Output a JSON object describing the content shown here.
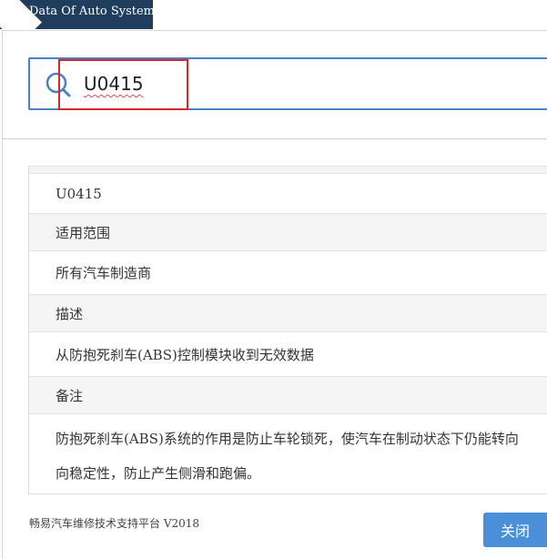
{
  "header": {
    "title": "Data Of Auto System"
  },
  "search": {
    "value": "U0415"
  },
  "results": {
    "code": "U0415",
    "scope_label": "适用范围",
    "scope_value": "所有汽车制造商",
    "desc_label": "描述",
    "desc_value": "从防抱死刹车(ABS)控制模块收到无效数据",
    "notes_label": "备注",
    "notes_line1": "防抱死刹车(ABS)系统的作用是防止车轮锁死，使汽车在制动状态下仍能转向",
    "notes_line2": "向稳定性，防止产生侧滑和跑偏。"
  },
  "footer": {
    "platform_text": "畅易汽车维修技术支持平台 V2018",
    "close_label": "关闭"
  },
  "colors": {
    "header_bg": "#1f3d5c",
    "search_border": "#4e7fc0",
    "highlight": "#d9262c",
    "button_bg": "#4a8fd8"
  },
  "icons": {
    "search": "search-icon"
  }
}
